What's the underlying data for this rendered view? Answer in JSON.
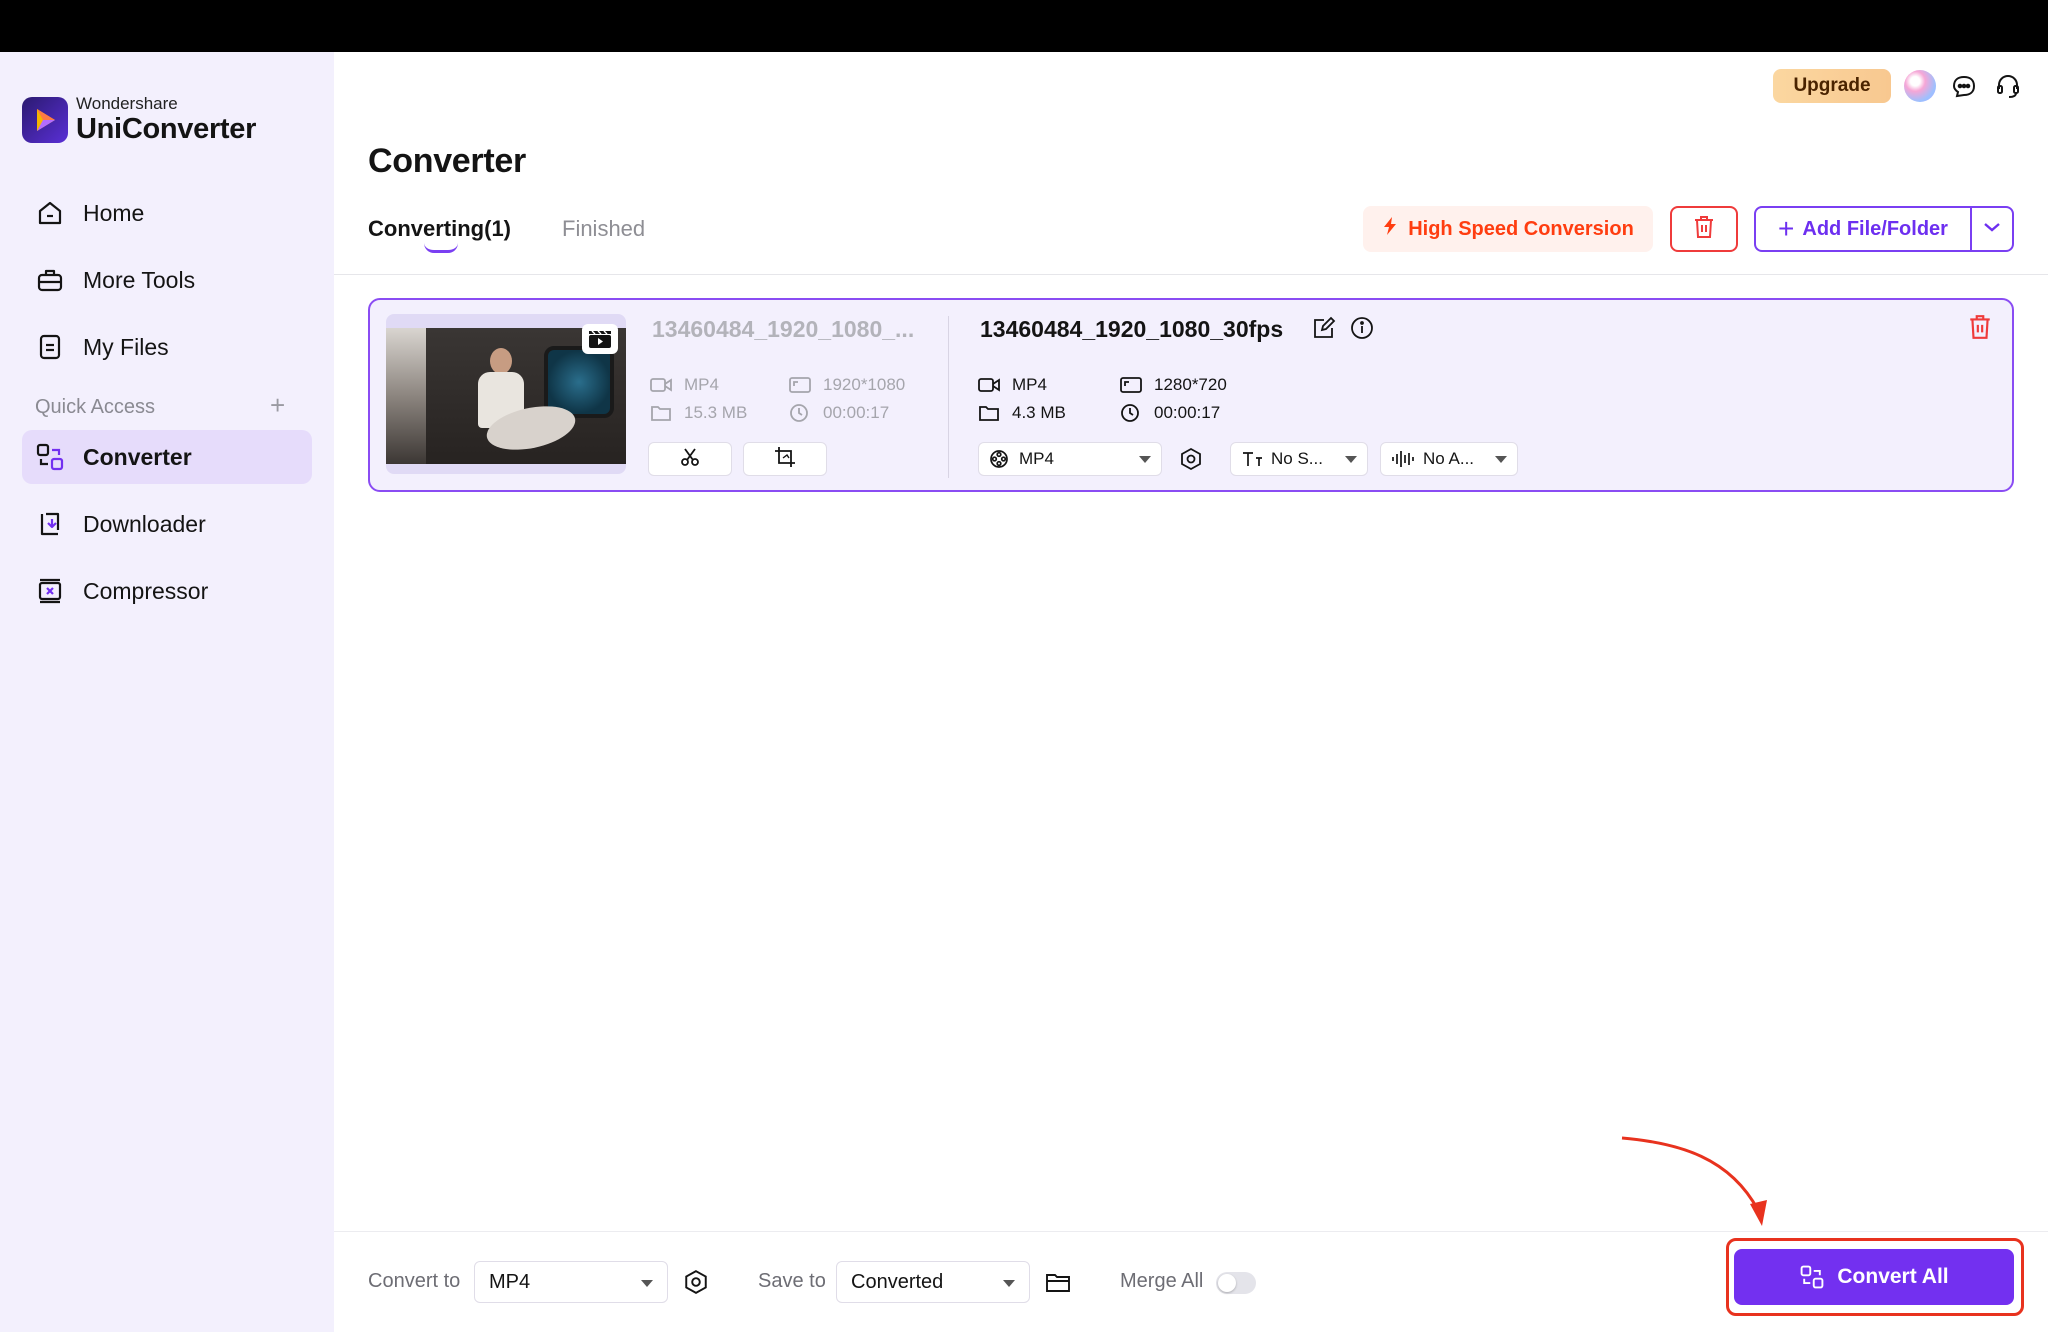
{
  "app": {
    "brand": "Wondershare",
    "name": "UniConverter",
    "accent": "#7330f0"
  },
  "sidebar": {
    "items": [
      {
        "label": "Home",
        "icon": "home-icon"
      },
      {
        "label": "More Tools",
        "icon": "toolbox-icon"
      },
      {
        "label": "My Files",
        "icon": "file-icon"
      },
      {
        "label": "Converter",
        "icon": "converter-icon",
        "active": true
      },
      {
        "label": "Downloader",
        "icon": "download-icon"
      },
      {
        "label": "Compressor",
        "icon": "compress-icon"
      }
    ],
    "quick_access_label": "Quick Access",
    "quick_access_add": "+"
  },
  "header": {
    "upgrade_label": "Upgrade"
  },
  "main": {
    "title": "Converter",
    "tabs": [
      {
        "label": "Converting(1)",
        "active": true
      },
      {
        "label": "Finished",
        "active": false
      }
    ],
    "high_speed_label": "High Speed Conversion",
    "add_file_label": "Add File/Folder"
  },
  "file": {
    "source": {
      "name": "13460484_1920_1080_...",
      "format": "MP4",
      "size": "15.3 MB",
      "resolution": "1920*1080",
      "duration": "00:00:17"
    },
    "target": {
      "name": "13460484_1920_1080_30fps",
      "format": "MP4",
      "size": "4.3 MB",
      "resolution": "1280*720",
      "duration": "00:00:17",
      "output_format": "MP4",
      "subtitle": "No S...",
      "audio": "No A..."
    }
  },
  "bottom": {
    "convert_to_label": "Convert to",
    "convert_to_value": "MP4",
    "save_to_label": "Save to",
    "save_to_value": "Converted",
    "merge_all_label": "Merge All",
    "merge_all_on": false,
    "convert_all_label": "Convert All"
  }
}
